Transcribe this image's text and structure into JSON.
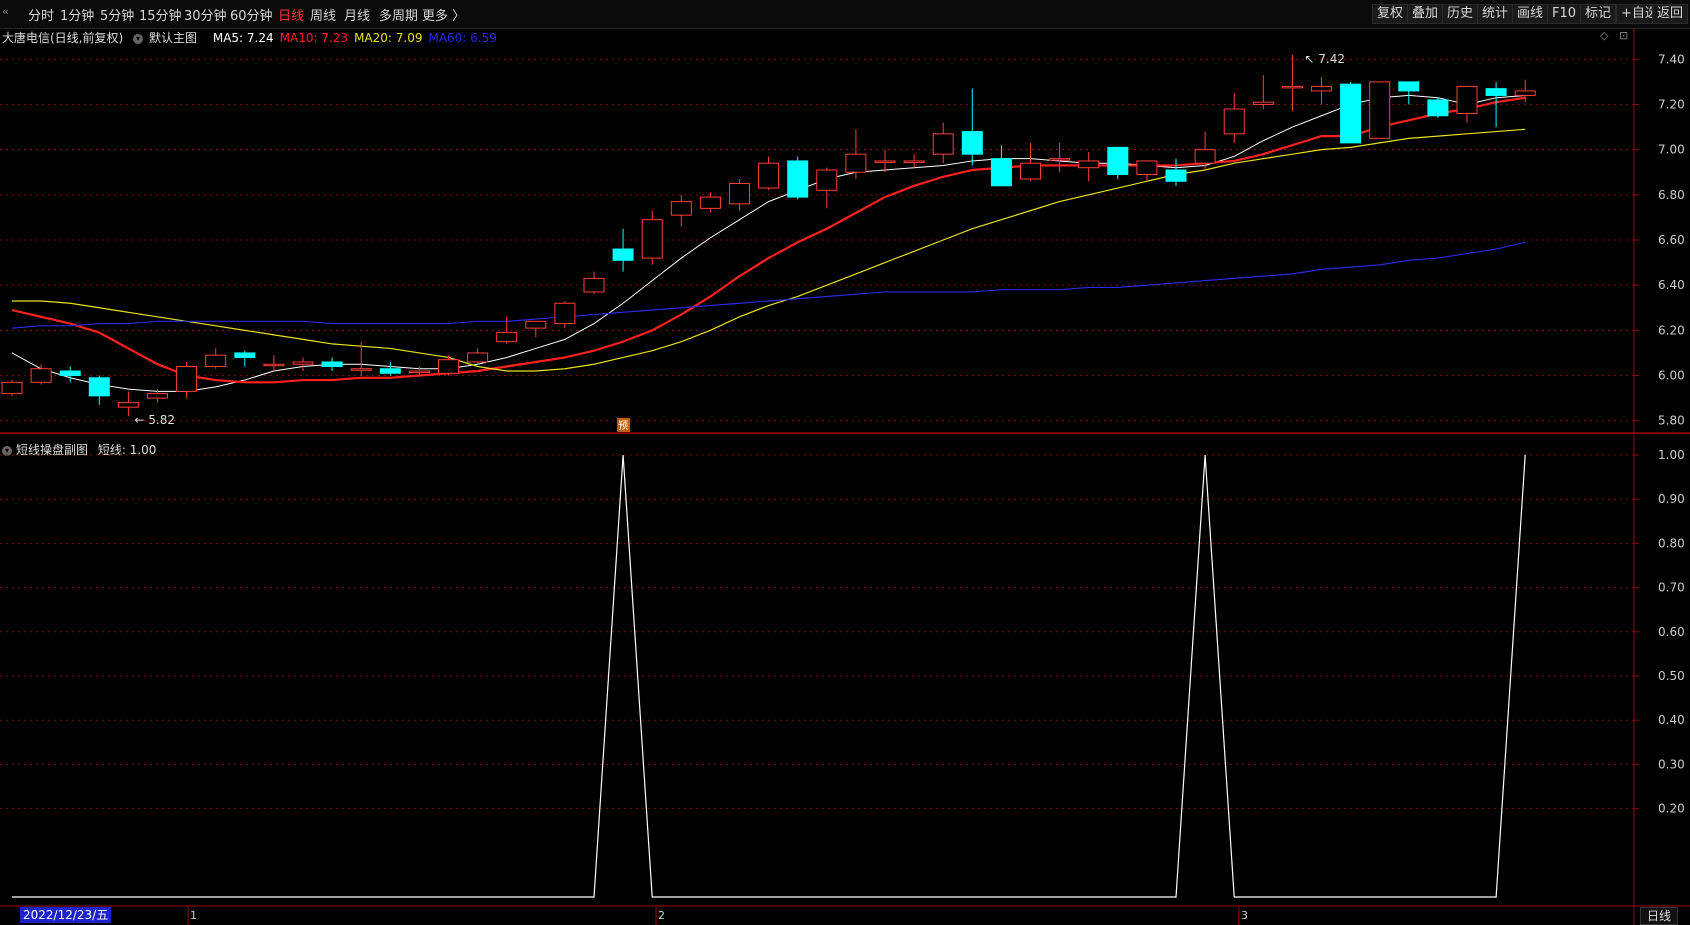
{
  "toolbar": {
    "corner_label": "«",
    "periods": [
      "分时",
      "1分钟",
      "5分钟",
      "15分钟",
      "30分钟",
      "60分钟",
      "日线",
      "周线",
      "月线",
      "多周期",
      "更多 〉"
    ],
    "active_period": "日线",
    "right_buttons": [
      "复权",
      "叠加",
      "历史",
      "统计",
      "画线",
      "F10",
      "标记",
      "+自选",
      "返回"
    ]
  },
  "main_chart": {
    "stock": "大唐电信(日线,前复权)",
    "template": "默认主图",
    "ma": [
      {
        "label": "MA5: 7.24",
        "color": "#ffffff"
      },
      {
        "label": "MA10: 7.23",
        "color": "#ff2020"
      },
      {
        "label": "MA20: 7.09",
        "color": "#e8e020"
      },
      {
        "label": "MA60: 6.59",
        "color": "#2a2ae0"
      }
    ],
    "high_label": "7.42",
    "low_label": "5.82",
    "marker": "预",
    "y_ticks": [
      "7.40",
      "7.20",
      "7.00",
      "6.80",
      "6.60",
      "6.40",
      "6.20",
      "6.00",
      "5.80"
    ]
  },
  "sub_chart": {
    "name": "短线操盘副图",
    "value_label": "短线: 1.00",
    "y_ticks": [
      "1.00",
      "0.90",
      "0.80",
      "0.70",
      "0.60",
      "0.50",
      "0.40",
      "0.30",
      "0.20"
    ]
  },
  "bottom": {
    "date": "2022/12/23/五",
    "month_labels": [
      "1",
      "2",
      "3"
    ],
    "period": "日线"
  },
  "colors": {
    "up": "#ff3c3c",
    "down": "#00ffff",
    "grid": "#7a1010",
    "axis": "#a00000"
  },
  "chart_data": {
    "type": "candlestick",
    "y_range": [
      5.75,
      7.45
    ],
    "candles": [
      [
        5.92,
        5.98,
        5.91,
        5.97
      ],
      [
        5.97,
        6.05,
        5.96,
        6.03
      ],
      [
        6.02,
        6.04,
        5.97,
        6.0
      ],
      [
        5.99,
        6.0,
        5.87,
        5.91
      ],
      [
        5.86,
        5.93,
        5.82,
        5.88
      ],
      [
        5.9,
        5.94,
        5.88,
        5.92
      ],
      [
        5.93,
        6.06,
        5.9,
        6.04
      ],
      [
        6.04,
        6.12,
        6.03,
        6.09
      ],
      [
        6.1,
        6.11,
        6.04,
        6.08
      ],
      [
        6.05,
        6.09,
        6.02,
        6.05
      ],
      [
        6.05,
        6.08,
        6.02,
        6.06
      ],
      [
        6.06,
        6.08,
        6.02,
        6.04
      ],
      [
        6.03,
        6.15,
        6.0,
        6.03
      ],
      [
        6.03,
        6.06,
        6.0,
        6.01
      ],
      [
        6.02,
        6.04,
        6.0,
        6.02
      ],
      [
        6.01,
        6.09,
        6.0,
        6.07
      ],
      [
        6.06,
        6.12,
        6.05,
        6.1
      ],
      [
        6.15,
        6.26,
        6.14,
        6.19
      ],
      [
        6.21,
        6.24,
        6.17,
        6.24
      ],
      [
        6.23,
        6.33,
        6.21,
        6.32
      ],
      [
        6.37,
        6.46,
        6.36,
        6.43
      ],
      [
        6.56,
        6.65,
        6.46,
        6.51
      ],
      [
        6.52,
        6.73,
        6.49,
        6.69
      ],
      [
        6.71,
        6.8,
        6.66,
        6.77
      ],
      [
        6.74,
        6.81,
        6.72,
        6.79
      ],
      [
        6.76,
        6.87,
        6.73,
        6.85
      ],
      [
        6.83,
        6.97,
        6.82,
        6.94
      ],
      [
        6.95,
        6.97,
        6.78,
        6.79
      ],
      [
        6.82,
        6.92,
        6.74,
        6.91
      ],
      [
        6.9,
        7.09,
        6.87,
        6.98
      ],
      [
        6.95,
        7.0,
        6.9,
        6.95
      ],
      [
        6.95,
        6.98,
        6.92,
        6.95
      ],
      [
        6.98,
        7.12,
        6.94,
        7.07
      ],
      [
        7.08,
        7.27,
        6.93,
        6.98
      ],
      [
        6.96,
        7.02,
        6.84,
        6.84
      ],
      [
        6.87,
        7.03,
        6.86,
        6.94
      ],
      [
        6.96,
        7.03,
        6.9,
        6.96
      ],
      [
        6.92,
        6.99,
        6.86,
        6.95
      ],
      [
        7.01,
        7.0,
        6.87,
        6.89
      ],
      [
        6.89,
        6.94,
        6.86,
        6.95
      ],
      [
        6.91,
        6.96,
        6.84,
        6.86
      ],
      [
        6.94,
        7.08,
        6.91,
        7.0
      ],
      [
        7.07,
        7.25,
        7.03,
        7.18
      ],
      [
        7.2,
        7.33,
        7.18,
        7.21
      ],
      [
        7.28,
        7.42,
        7.17,
        7.28
      ],
      [
        7.26,
        7.32,
        7.2,
        7.28
      ],
      [
        7.29,
        7.3,
        7.03,
        7.03
      ],
      [
        7.05,
        7.3,
        7.05,
        7.3
      ],
      [
        7.3,
        7.3,
        7.2,
        7.26
      ],
      [
        7.22,
        7.23,
        7.14,
        7.15
      ],
      [
        7.16,
        7.28,
        7.12,
        7.28
      ],
      [
        7.27,
        7.3,
        7.1,
        7.24
      ],
      [
        7.24,
        7.31,
        7.21,
        7.26
      ]
    ],
    "ma5": [
      6.1,
      6.03,
      5.99,
      5.96,
      5.94,
      5.93,
      5.93,
      5.95,
      5.98,
      6.02,
      6.04,
      6.05,
      6.05,
      6.04,
      6.03,
      6.03,
      6.05,
      6.08,
      6.12,
      6.16,
      6.23,
      6.32,
      6.42,
      6.52,
      6.61,
      6.69,
      6.77,
      6.82,
      6.87,
      6.9,
      6.91,
      6.92,
      6.93,
      6.95,
      6.96,
      6.96,
      6.95,
      6.94,
      6.94,
      6.93,
      6.92,
      6.93,
      6.97,
      7.04,
      7.1,
      7.15,
      7.2,
      7.23,
      7.24,
      7.23,
      7.2,
      7.23,
      7.24
    ],
    "ma10": [
      6.29,
      6.26,
      6.23,
      6.19,
      6.12,
      6.05,
      6.0,
      5.98,
      5.97,
      5.97,
      5.98,
      5.98,
      5.99,
      5.99,
      6.0,
      6.01,
      6.02,
      6.04,
      6.06,
      6.08,
      6.11,
      6.15,
      6.2,
      6.27,
      6.35,
      6.44,
      6.52,
      6.59,
      6.65,
      6.72,
      6.79,
      6.84,
      6.88,
      6.91,
      6.92,
      6.93,
      6.93,
      6.93,
      6.93,
      6.93,
      6.93,
      6.94,
      6.95,
      6.98,
      7.02,
      7.06,
      7.06,
      7.1,
      7.13,
      7.16,
      7.18,
      7.21,
      7.23
    ],
    "ma20": [
      6.33,
      6.33,
      6.32,
      6.3,
      6.28,
      6.26,
      6.24,
      6.22,
      6.2,
      6.18,
      6.16,
      6.14,
      6.13,
      6.12,
      6.1,
      6.08,
      6.04,
      6.02,
      6.02,
      6.03,
      6.05,
      6.08,
      6.11,
      6.15,
      6.2,
      6.26,
      6.31,
      6.35,
      6.4,
      6.45,
      6.5,
      6.55,
      6.6,
      6.65,
      6.69,
      6.73,
      6.77,
      6.8,
      6.83,
      6.86,
      6.89,
      6.91,
      6.94,
      6.96,
      6.98,
      7.0,
      7.01,
      7.03,
      7.05,
      7.06,
      7.07,
      7.08,
      7.09
    ],
    "ma60": [
      6.21,
      6.22,
      6.22,
      6.23,
      6.23,
      6.24,
      6.24,
      6.24,
      6.24,
      6.24,
      6.24,
      6.23,
      6.23,
      6.23,
      6.23,
      6.23,
      6.24,
      6.24,
      6.25,
      6.26,
      6.27,
      6.28,
      6.29,
      6.3,
      6.31,
      6.32,
      6.33,
      6.34,
      6.35,
      6.36,
      6.37,
      6.37,
      6.37,
      6.37,
      6.38,
      6.38,
      6.38,
      6.39,
      6.39,
      6.4,
      6.41,
      6.42,
      6.43,
      6.44,
      6.45,
      6.47,
      6.48,
      6.49,
      6.51,
      6.52,
      6.54,
      6.56,
      6.59
    ],
    "sub_y_range": [
      0,
      1.0
    ],
    "short_line": [
      0,
      0,
      0,
      0,
      0,
      0,
      0,
      0,
      0,
      0,
      0,
      0,
      0,
      0,
      0,
      0,
      0,
      0,
      0,
      0,
      0,
      1,
      0,
      0,
      0,
      0,
      0,
      0,
      0,
      0,
      0,
      0,
      0,
      0,
      0,
      0,
      0,
      0,
      0,
      0,
      0,
      1,
      0,
      0,
      0,
      0,
      0,
      0,
      0,
      0,
      0,
      0,
      1
    ]
  }
}
